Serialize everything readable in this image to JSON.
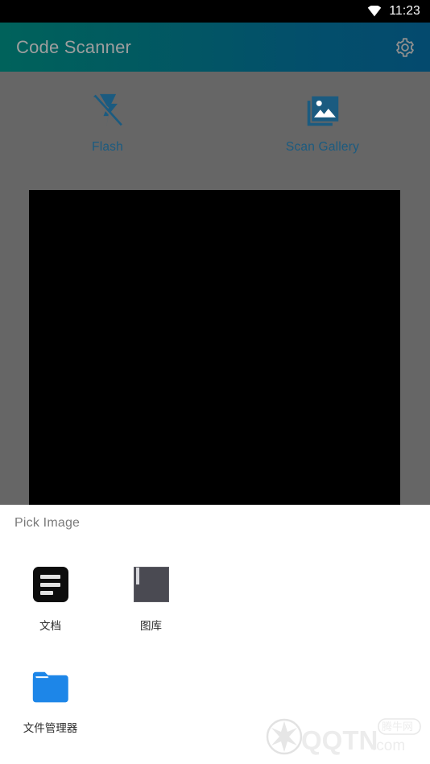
{
  "status_bar": {
    "wifi_icon": "wifi-icon",
    "time": "11:23"
  },
  "app_bar": {
    "title": "Code Scanner",
    "settings_icon": "gear-icon",
    "gradient_from": "#00625b",
    "gradient_to": "#044a6e",
    "title_color": "#9e9e9e"
  },
  "camera_screen": {
    "scrim_color": "#666666",
    "preview_color": "#000000",
    "actions": [
      {
        "label": "Flash",
        "icon": "flash-off-icon",
        "color": "#1b5b80"
      },
      {
        "label": "Scan Gallery",
        "icon": "photo-library-icon",
        "color": "#1b5b80"
      }
    ]
  },
  "bottom_sheet": {
    "title": "Pick Image",
    "title_color": "#7a7a7a",
    "apps": [
      {
        "label": "文档",
        "icon": "documents-app-icon"
      },
      {
        "label": "图库",
        "icon": "gallery-app-icon"
      },
      {
        "label": "文件管理器",
        "icon": "file-manager-app-icon"
      }
    ]
  },
  "watermark": {
    "text": "QQTN.com",
    "badge": "腾牛网"
  }
}
